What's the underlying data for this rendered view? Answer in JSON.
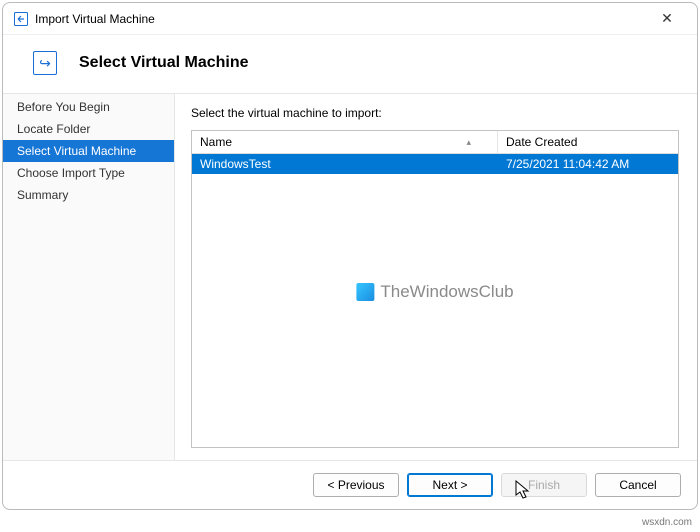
{
  "window": {
    "title": "Import Virtual Machine",
    "close_glyph": "✕"
  },
  "header": {
    "icon_glyph": "↪",
    "title": "Select Virtual Machine"
  },
  "sidebar": {
    "items": [
      {
        "label": "Before You Begin"
      },
      {
        "label": "Locate Folder"
      },
      {
        "label": "Select Virtual Machine"
      },
      {
        "label": "Choose Import Type"
      },
      {
        "label": "Summary"
      }
    ]
  },
  "main": {
    "instruction": "Select the virtual machine to import:",
    "columns": {
      "name": "Name",
      "date": "Date Created",
      "sort_caret": "▴"
    },
    "rows": [
      {
        "name": "WindowsTest",
        "date": "7/25/2021 11:04:42 AM"
      }
    ],
    "watermark": "TheWindowsClub"
  },
  "buttons": {
    "previous": "< Previous",
    "next": "Next >",
    "finish": "Finish",
    "cancel": "Cancel"
  },
  "attribution": "wsxdn.com"
}
